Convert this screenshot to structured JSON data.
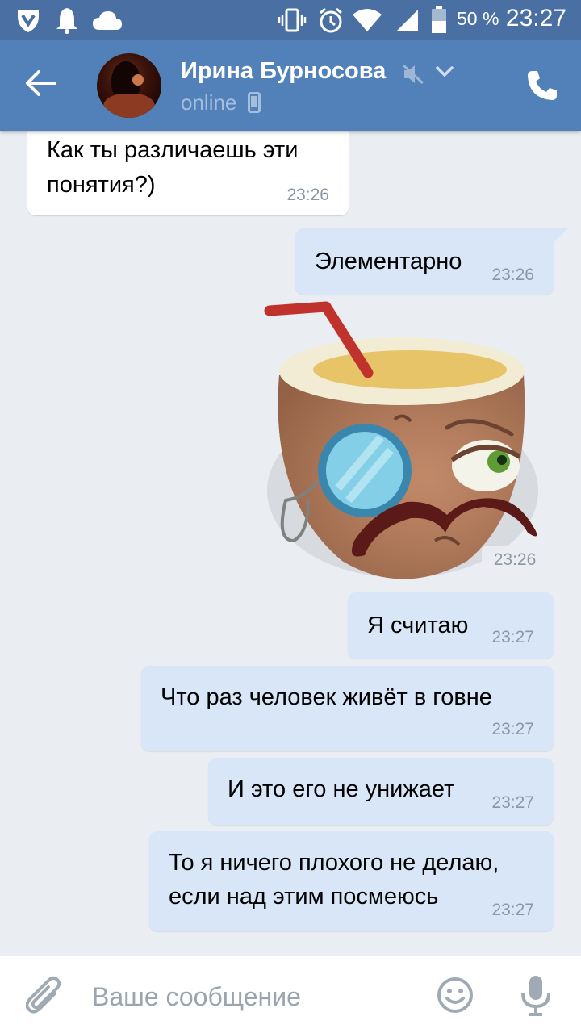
{
  "status_bar": {
    "battery_text": "50 %",
    "time": "23:27",
    "icons": [
      "vpn-shield-icon",
      "notification-bell-icon",
      "cloud-icon",
      "vibrate-icon",
      "alarm-icon",
      "wifi-icon",
      "signal-icon",
      "battery-icon"
    ]
  },
  "header": {
    "contact_name": "Ирина Бурносова",
    "status": "online",
    "icons": [
      "back-arrow-icon",
      "mute-icon",
      "chevron-down-icon",
      "phone-icon",
      "mobile-device-icon"
    ]
  },
  "messages": [
    {
      "direction": "in",
      "text_lines": [
        "Как ты различаешь эти",
        "понятия?)"
      ],
      "time": "23:26"
    },
    {
      "direction": "out",
      "text_lines": [
        "Элементарно"
      ],
      "time": "23:26"
    },
    {
      "direction": "in",
      "type": "sticker",
      "sticker": "coconut-with-monocle-and-mustache",
      "time": "23:26"
    },
    {
      "direction": "out",
      "text_lines": [
        "Я считаю"
      ],
      "time": "23:27"
    },
    {
      "direction": "out",
      "text_lines": [
        "Что раз человек живёт в говне"
      ],
      "time": "23:27"
    },
    {
      "direction": "out",
      "text_lines": [
        "И это его не унижает"
      ],
      "time": "23:27"
    },
    {
      "direction": "out",
      "text_lines": [
        "То я ничего плохого не делаю,",
        "если над этим посмеюсь"
      ],
      "time": "23:27"
    }
  ],
  "composer": {
    "placeholder": "Ваше сообщение",
    "icons": [
      "paperclip-icon",
      "emoji-icon",
      "microphone-icon"
    ]
  },
  "colors": {
    "header_bg": "#5181b8",
    "status_bar_bg": "#4a70a3",
    "chat_bg": "#eaedf2",
    "outgoing_bubble": "#d8e6f7",
    "incoming_bubble": "#ffffff"
  }
}
